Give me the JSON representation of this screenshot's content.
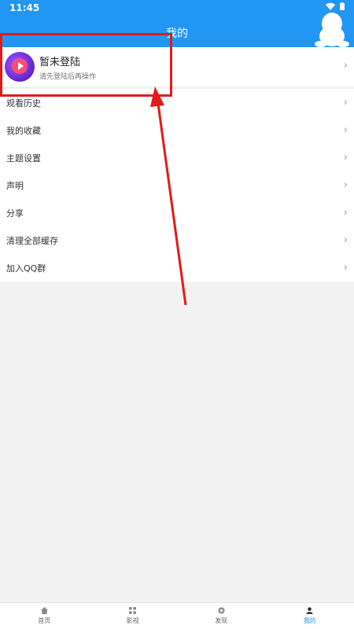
{
  "status_bar": {
    "time": "11:45",
    "wifi_icon": "wifi-icon",
    "battery_icon": "battery-icon"
  },
  "header": {
    "title": "我的",
    "mascot_icon": "penguin-icon"
  },
  "login": {
    "title": "暂未登陆",
    "subtitle": "请先登陆后再操作",
    "avatar_icon": "app-logo-icon"
  },
  "menu": {
    "items": [
      {
        "label": "观看历史"
      },
      {
        "label": "我的收藏"
      },
      {
        "label": "主题设置"
      },
      {
        "label": "声明"
      },
      {
        "label": "分享"
      },
      {
        "label": "清理全部缓存"
      },
      {
        "label": "加入QQ群"
      }
    ],
    "chevron": "›"
  },
  "bottom_nav": {
    "items": [
      {
        "label": "首页",
        "icon": "home-icon",
        "active": false
      },
      {
        "label": "影视",
        "icon": "grid-icon",
        "active": false
      },
      {
        "label": "发现",
        "icon": "discover-icon",
        "active": false
      },
      {
        "label": "我的",
        "icon": "user-icon",
        "active": true
      }
    ]
  },
  "colors": {
    "primary": "#2196f3",
    "annotation": "#e21a1a",
    "background": "#f2f2f2"
  }
}
